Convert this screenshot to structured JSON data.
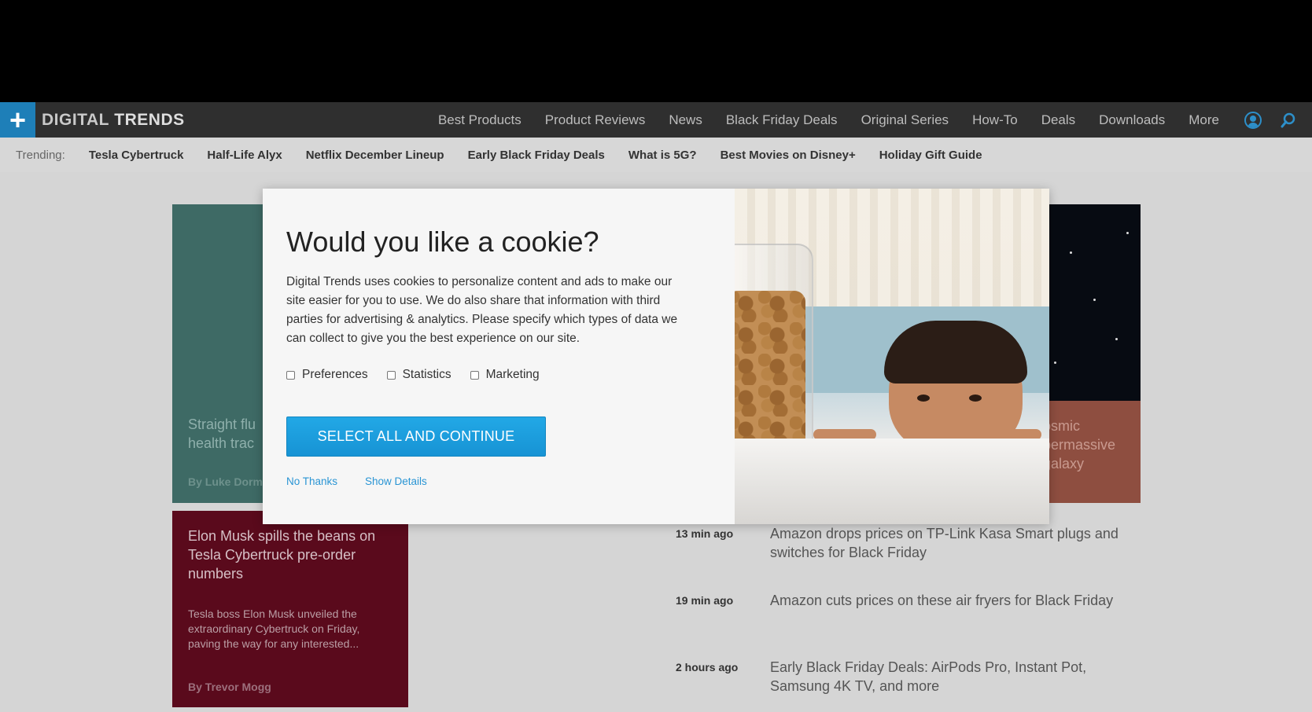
{
  "topnav": {
    "logo_text_light": "DIGITAL",
    "logo_text_bold": "TRENDS",
    "links": [
      "Best Products",
      "Product Reviews",
      "News",
      "Black Friday Deals",
      "Original Series",
      "How-To",
      "Deals",
      "Downloads",
      "More"
    ]
  },
  "trending": {
    "label": "Trending:",
    "items": [
      "Tesla Cybertruck",
      "Half-Life Alyx",
      "Netflix December Lineup",
      "Early Black Friday Deals",
      "What is 5G?",
      "Best Movies on Disney+",
      "Holiday Gift Guide"
    ]
  },
  "cards": {
    "teal": {
      "title": "Straight flu\nhealth trac",
      "byline": "By Luke Dorm"
    },
    "orange": {
      "title": "osmic\npermassive\ngalaxy"
    },
    "maroon": {
      "title": "Elon Musk spills the beans on Tesla Cybertruck pre-order numbers",
      "description": "Tesla boss Elon Musk unveiled the extraordinary Cybertruck on Friday, paving the way for any interested...",
      "byline": "By Trevor Mogg"
    }
  },
  "feed": [
    {
      "time": "13 min ago",
      "title": "Amazon drops prices on TP-Link Kasa Smart plugs and switches for Black Friday"
    },
    {
      "time": "19 min ago",
      "title": "Amazon cuts prices on these air fryers for Black Friday"
    },
    {
      "time": "2 hours ago",
      "title": "Early Black Friday Deals: AirPods Pro, Instant Pot, Samsung 4K TV, and more"
    }
  ],
  "cookie_modal": {
    "title": "Would you like a cookie?",
    "description": "Digital Trends uses cookies to personalize content and ads to make our site easier for you to use. We do also share that information with third parties for advertising & analytics. Please specify which types of data we can collect to give you the best experience on our site.",
    "options": [
      "Preferences",
      "Statistics",
      "Marketing"
    ],
    "primary_button": "SELECT ALL AND CONTINUE",
    "no_thanks": "No Thanks",
    "show_details": "Show Details"
  },
  "colors": {
    "accent_blue": "#1e7fb8",
    "button_blue": "#1793d4",
    "link_blue": "#2a95d4",
    "nav_bg": "#2f2f2f"
  }
}
